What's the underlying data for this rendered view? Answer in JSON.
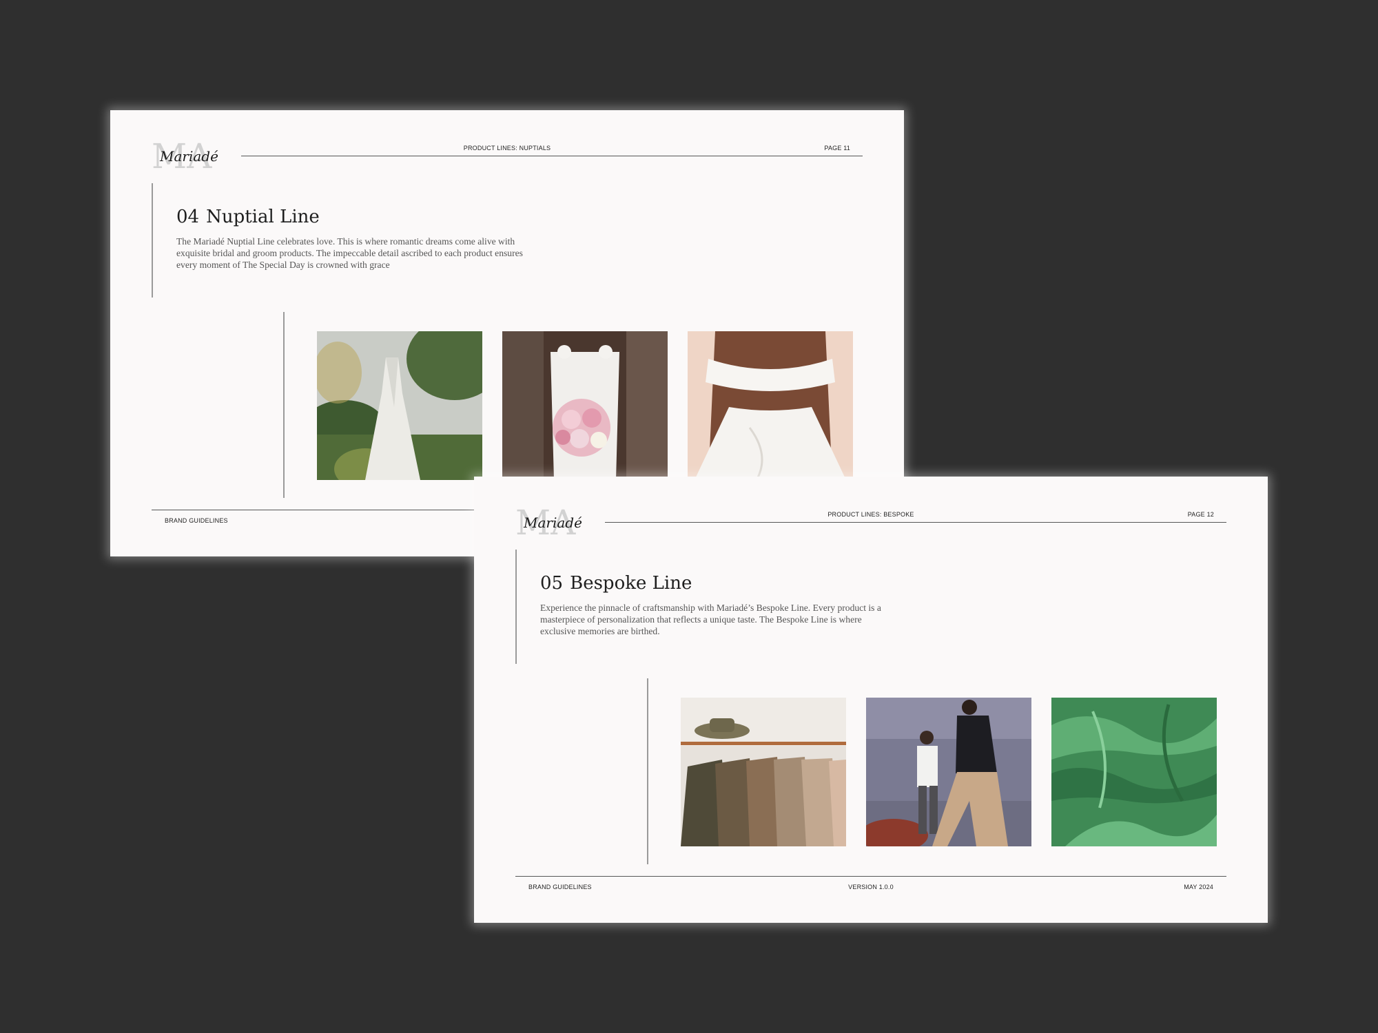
{
  "pages": [
    {
      "logo": {
        "monogram": "MA",
        "script": "Mariadé"
      },
      "header": {
        "section": "PRODUCT LINES: NUPTIALS",
        "page": "PAGE 11"
      },
      "title": {
        "number": "04",
        "text": "Nuptial Line"
      },
      "description": "The Mariadé Nuptial Line celebrates love. This is where romantic dreams come alive with exquisite bridal and groom products. The impeccable detail ascribed to each product ensures every moment of The Special Day is crowned with grace",
      "footer": {
        "left": "BRAND GUIDELINES"
      }
    },
    {
      "logo": {
        "monogram": "MA",
        "script": "Mariadé"
      },
      "header": {
        "section": "PRODUCT LINES: BESPOKE",
        "page": "PAGE 12"
      },
      "title": {
        "number": "05",
        "text": "Bespoke Line"
      },
      "description": "Experience the pinnacle of craftsmanship with Mariadé’s Bespoke Line. Every product is a masterpiece of personalization that reflects a unique taste. The Bespoke Line is where exclusive memories are birthed.",
      "footer": {
        "left": "BRAND GUIDELINES",
        "center": "VERSION 1.0.0",
        "right": "MAY 2024"
      }
    }
  ],
  "colors": {
    "background": "#2f2f2f",
    "page": "#fbf9f9",
    "text": "#1e1e1e"
  }
}
